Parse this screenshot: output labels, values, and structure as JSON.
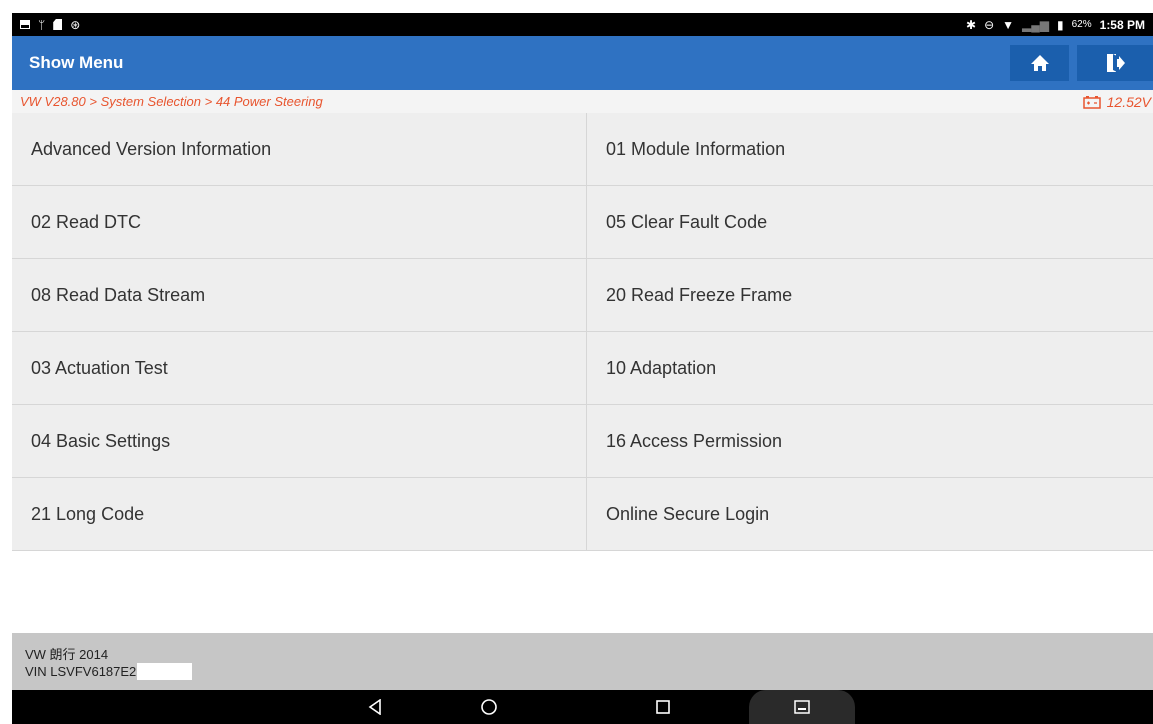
{
  "statusbar": {
    "battery_percent": "62%",
    "time": "1:58 PM"
  },
  "header": {
    "title": "Show Menu"
  },
  "breadcrumb": {
    "path": "VW V28.80 > System Selection > 44 Power Steering",
    "voltage": "12.52V"
  },
  "menu": {
    "items": [
      {
        "label": "Advanced Version Information"
      },
      {
        "label": "01 Module Information"
      },
      {
        "label": "02 Read DTC"
      },
      {
        "label": "05 Clear Fault Code"
      },
      {
        "label": "08 Read Data Stream"
      },
      {
        "label": "20 Read Freeze Frame"
      },
      {
        "label": "03 Actuation Test"
      },
      {
        "label": "10 Adaptation"
      },
      {
        "label": "04 Basic Settings"
      },
      {
        "label": "16 Access Permission"
      },
      {
        "label": "21 Long Code"
      },
      {
        "label": "Online Secure Login"
      }
    ]
  },
  "footer": {
    "vehicle": "VW 朗行 2014",
    "vin": "VIN LSVFV6187E2"
  },
  "colors": {
    "header_bg": "#2f72c2",
    "breadcrumb_text": "#e8552f",
    "menu_bg": "#eeeeee",
    "footer_bg": "#c6c6c6"
  },
  "icons": {
    "home": "home-icon",
    "exit": "exit-icon",
    "battery": "battery-icon",
    "nav_back": "back-triangle-icon",
    "nav_home": "home-circle-icon",
    "nav_recent": "recent-square-icon",
    "nav_extra": "screenshot-icon"
  }
}
